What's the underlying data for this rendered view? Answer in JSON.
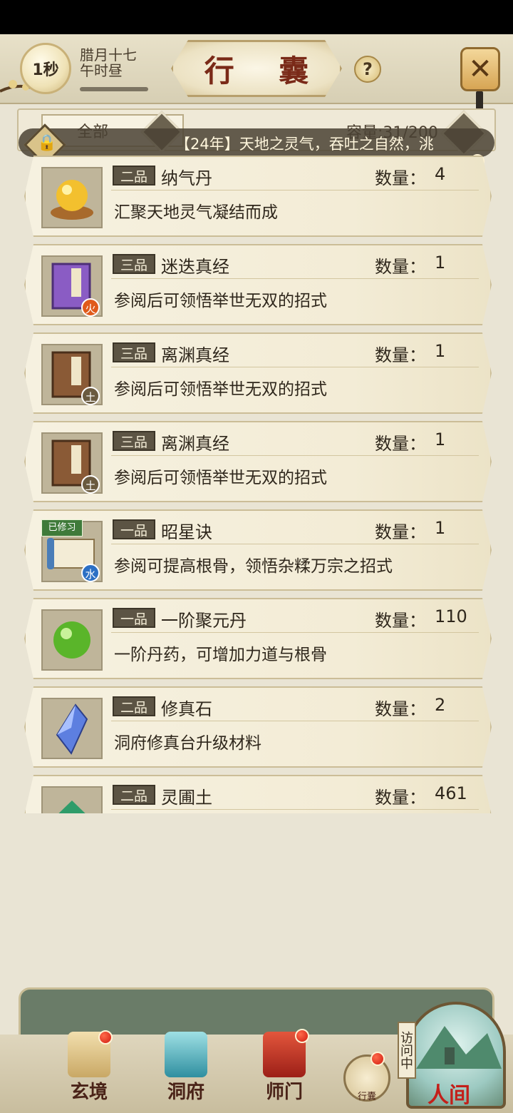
{
  "header": {
    "timer": "1秒",
    "date_line1": "腊月十七",
    "date_line2": "午时昼",
    "title": "行 囊",
    "help_icon": "?"
  },
  "filter": {
    "selected": "全部",
    "capacity": "容量:31/200"
  },
  "ticker": {
    "text": "【24年】天地之灵气，吞吐之自然，洮"
  },
  "items": [
    {
      "grade": "二品",
      "name": "纳气丹",
      "qty_label": "数量：",
      "qty": "4",
      "desc": "汇聚天地灵气凝结而成",
      "icon": "golden-pill-icon"
    },
    {
      "grade": "三品",
      "name": "迷迭真经",
      "qty_label": "数量：",
      "qty": "1",
      "desc": "参阅后可领悟举世无双的招式",
      "icon": "purple-book-icon",
      "element": "火",
      "element_color": "#e05a1b"
    },
    {
      "grade": "三品",
      "name": "离渊真经",
      "qty_label": "数量：",
      "qty": "1",
      "desc": "参阅后可领悟举世无双的招式",
      "icon": "brown-book-icon",
      "element": "土",
      "element_color": "#6a5a3f"
    },
    {
      "grade": "三品",
      "name": "离渊真经",
      "qty_label": "数量：",
      "qty": "1",
      "desc": "参阅后可领悟举世无双的招式",
      "icon": "brown-book-icon",
      "element": "土",
      "element_color": "#6a5a3f"
    },
    {
      "grade": "一品",
      "name": "昭星诀",
      "qty_label": "数量：",
      "qty": "1",
      "desc": "参阅可提高根骨，领悟杂糅万宗之招式",
      "icon": "scroll-icon",
      "element": "水",
      "element_color": "#2b6fc4",
      "tag": "已修习"
    },
    {
      "grade": "一品",
      "name": "一阶聚元丹",
      "qty_label": "数量：",
      "qty": "110",
      "desc": "一阶丹药，可增加力道与根骨",
      "icon": "green-pill-icon"
    },
    {
      "grade": "二品",
      "name": "修真石",
      "qty_label": "数量：",
      "qty": "2",
      "desc": "洞府修真台升级材料",
      "icon": "blue-crystal-icon"
    },
    {
      "grade": "二品",
      "name": "灵圃土",
      "qty_label": "数量：",
      "qty": "461",
      "desc": "",
      "icon": "soil-mound-icon"
    }
  ],
  "nav": {
    "items": [
      "玄境",
      "洞府",
      "师门"
    ],
    "bag_label": "行囊",
    "visiting": "访问中",
    "renjian": "人间"
  }
}
